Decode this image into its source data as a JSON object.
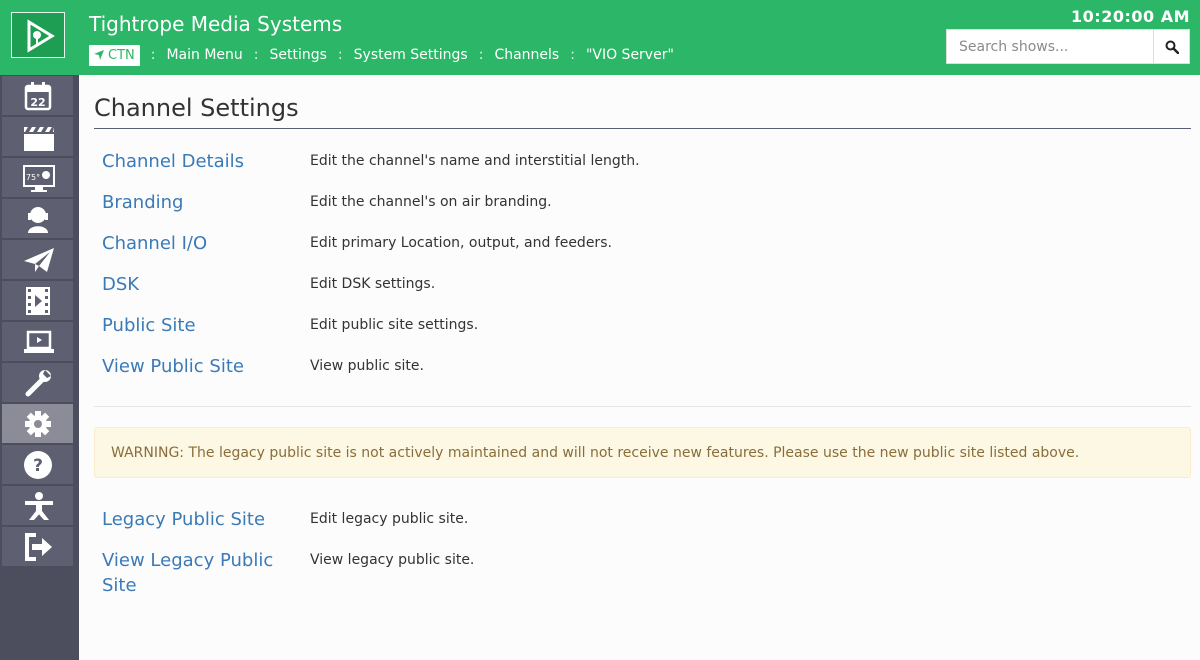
{
  "app": {
    "title": "Tightrope Media Systems",
    "clock": "10:20:00 AM"
  },
  "colors": {
    "brand_green": "#2bb767",
    "sidebar": "#4c4e5d",
    "link_blue": "#3a7ab7",
    "warning_bg": "#fcf8e3",
    "warning_text": "#8a6d3b"
  },
  "breadcrumb": {
    "badge": "CTN",
    "badge_icon": "location-arrow-icon",
    "separator": ":",
    "items": [
      "Main Menu",
      "Settings",
      "System Settings",
      "Channels",
      "\"VIO Server\""
    ]
  },
  "search": {
    "placeholder": "Search shows...",
    "value": "",
    "icon": "search-icon"
  },
  "sidebar": {
    "logo_icon": "play-logo-icon",
    "icons": [
      "calendar-icon",
      "clapperboard-icon",
      "weather-display-icon",
      "person-icon",
      "paper-plane-icon",
      "film-icon",
      "laptop-play-icon",
      "wrench-icon",
      "gear-icon",
      "help-icon",
      "stretch-person-icon",
      "sign-out-icon"
    ],
    "active_index": 8
  },
  "page": {
    "title": "Channel Settings",
    "settings": [
      {
        "label": "Channel Details",
        "description": "Edit the channel's name and interstitial length."
      },
      {
        "label": "Branding",
        "description": "Edit the channel's on air branding."
      },
      {
        "label": "Channel I/O",
        "description": "Edit primary Location, output, and feeders."
      },
      {
        "label": "DSK",
        "description": "Edit DSK settings."
      },
      {
        "label": "Public Site",
        "description": "Edit public site settings."
      },
      {
        "label": "View Public Site",
        "description": "View public site."
      }
    ],
    "warning": "WARNING: The legacy public site is not actively maintained and will not receive new features. Please use the new public site listed above.",
    "legacy_settings": [
      {
        "label": "Legacy Public Site",
        "description": "Edit legacy public site."
      },
      {
        "label": "View Legacy Public Site",
        "description": "View legacy public site."
      }
    ]
  }
}
